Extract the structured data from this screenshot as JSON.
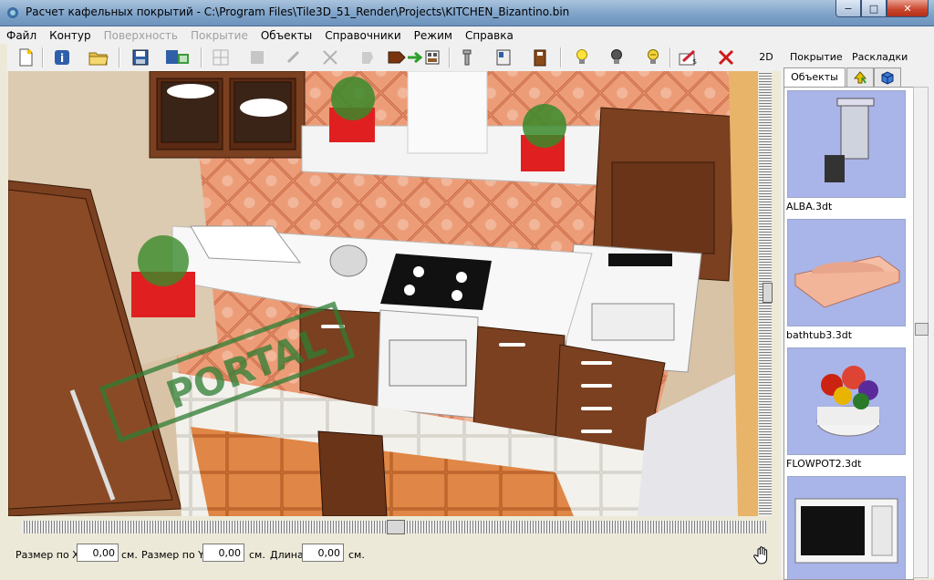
{
  "window": {
    "title": "Расчет кафельных покрытий - C:\\Program Files\\Tile3D_51_Render\\Projects\\KITCHEN_Bizantino.bin",
    "minimize": "−",
    "maximize": "□",
    "close": "✕"
  },
  "menu": [
    {
      "label": "Файл",
      "enabled": true
    },
    {
      "label": "Контур",
      "enabled": true
    },
    {
      "label": "Поверхность",
      "enabled": false
    },
    {
      "label": "Покрытие",
      "enabled": false
    },
    {
      "label": "Объекты",
      "enabled": true
    },
    {
      "label": "Справочники",
      "enabled": true
    },
    {
      "label": "Режим",
      "enabled": true
    },
    {
      "label": "Справка",
      "enabled": true
    }
  ],
  "toolbar": {
    "view_2d": "2D"
  },
  "watermark": {
    "text": "PORTAL",
    "tm": "™"
  },
  "sizes": {
    "x_label": "Размер по X",
    "x_value": "0,00",
    "x_unit": "см.",
    "y_label": "Размер по Y",
    "y_value": "0,00",
    "y_unit": "см.",
    "len_label": "Длина",
    "len_value": "0,00",
    "len_unit": "см."
  },
  "panel": {
    "tab_cover": "Покрытие",
    "tab_layout": "Раскладки",
    "tab_objects": "Объекты",
    "items": [
      {
        "label": "ALBA.3dt",
        "icon": "towel-holder-icon"
      },
      {
        "label": "bathtub3.3dt",
        "icon": "bathtub-icon"
      },
      {
        "label": "FLOWPOT2.3dt",
        "icon": "flowerpot-icon"
      },
      {
        "label": "",
        "icon": "microwave-icon"
      }
    ]
  },
  "colors": {
    "accent": "#6d93bd",
    "wood": "#7a4020",
    "tile": "#e8926a"
  }
}
